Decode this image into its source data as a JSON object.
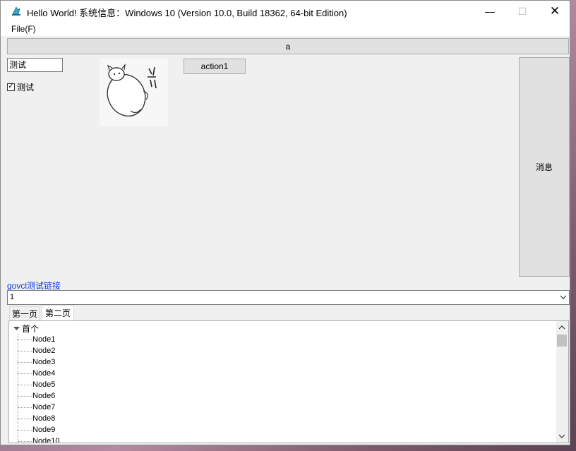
{
  "window": {
    "title": "Hello World! 系统信息：Windows 10 (Version 10.0, Build 18362, 64-bit Edition)",
    "minimize_symbol": "—",
    "maximize_symbol": "☐",
    "close_symbol": "✕",
    "app_icon": "app-icon"
  },
  "menu": {
    "file_label": "File(F)"
  },
  "top_panel": {
    "label": "a"
  },
  "edit": {
    "value": "测试"
  },
  "checkbox": {
    "label": "测试",
    "checked": true,
    "check_glyph": "✓"
  },
  "image": {
    "icon": "sticker-image"
  },
  "action_button": {
    "label": "action1"
  },
  "message_button": {
    "label": "消息"
  },
  "link": {
    "text": "govcl测试链接",
    "color": "#0b3bd9"
  },
  "combo": {
    "value": "1"
  },
  "tabs": [
    {
      "label": "第一页",
      "active": false
    },
    {
      "label": "第二页",
      "active": true
    }
  ],
  "tree": {
    "root": "首个",
    "nodes": [
      "Node1",
      "Node2",
      "Node3",
      "Node4",
      "Node5",
      "Node6",
      "Node7",
      "Node8",
      "Node9",
      "Node10"
    ]
  }
}
